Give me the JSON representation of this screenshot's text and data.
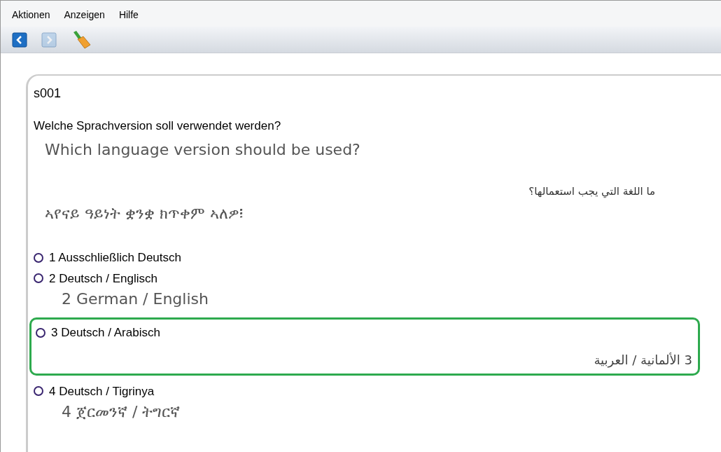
{
  "menu": [
    "Aktionen",
    "Anzeigen",
    "Hilfe"
  ],
  "toolbar": [
    {
      "kind": "back",
      "disabled": false
    },
    {
      "kind": "forward",
      "disabled": true
    },
    {
      "kind": "broom",
      "disabled": false
    }
  ],
  "question": {
    "id": "s001",
    "texts": [
      {
        "text": "Welche Sprachversion soll verwendet werden?",
        "kind": "primary"
      },
      {
        "text": "Which language version should be used?",
        "kind": "translation"
      },
      {
        "text": "ما اللغة التي يجب استعمالها؟",
        "kind": "rtl"
      },
      {
        "text": "ኣየናይ ዓይነት ቋንቋ ክጥቀም ኣለዎ፧",
        "kind": "translation"
      }
    ]
  },
  "options": [
    {
      "label": "1 Ausschließlich Deutsch",
      "selected": false,
      "highlighted": false
    },
    {
      "label": "2 Deutsch / Englisch",
      "selected": false,
      "highlighted": false,
      "translation": {
        "text": "2 German / English",
        "kind": "translation"
      }
    },
    {
      "label": "3 Deutsch / Arabisch",
      "selected": false,
      "highlighted": true,
      "translation": {
        "text": "3 الألمانية / العربية",
        "kind": "rtl"
      }
    },
    {
      "label": "4 Deutsch / Tigrinya",
      "selected": false,
      "highlighted": false,
      "translation": {
        "text": "4 ጀርመንኛ / ትግርኛ",
        "kind": "translation"
      }
    }
  ]
}
